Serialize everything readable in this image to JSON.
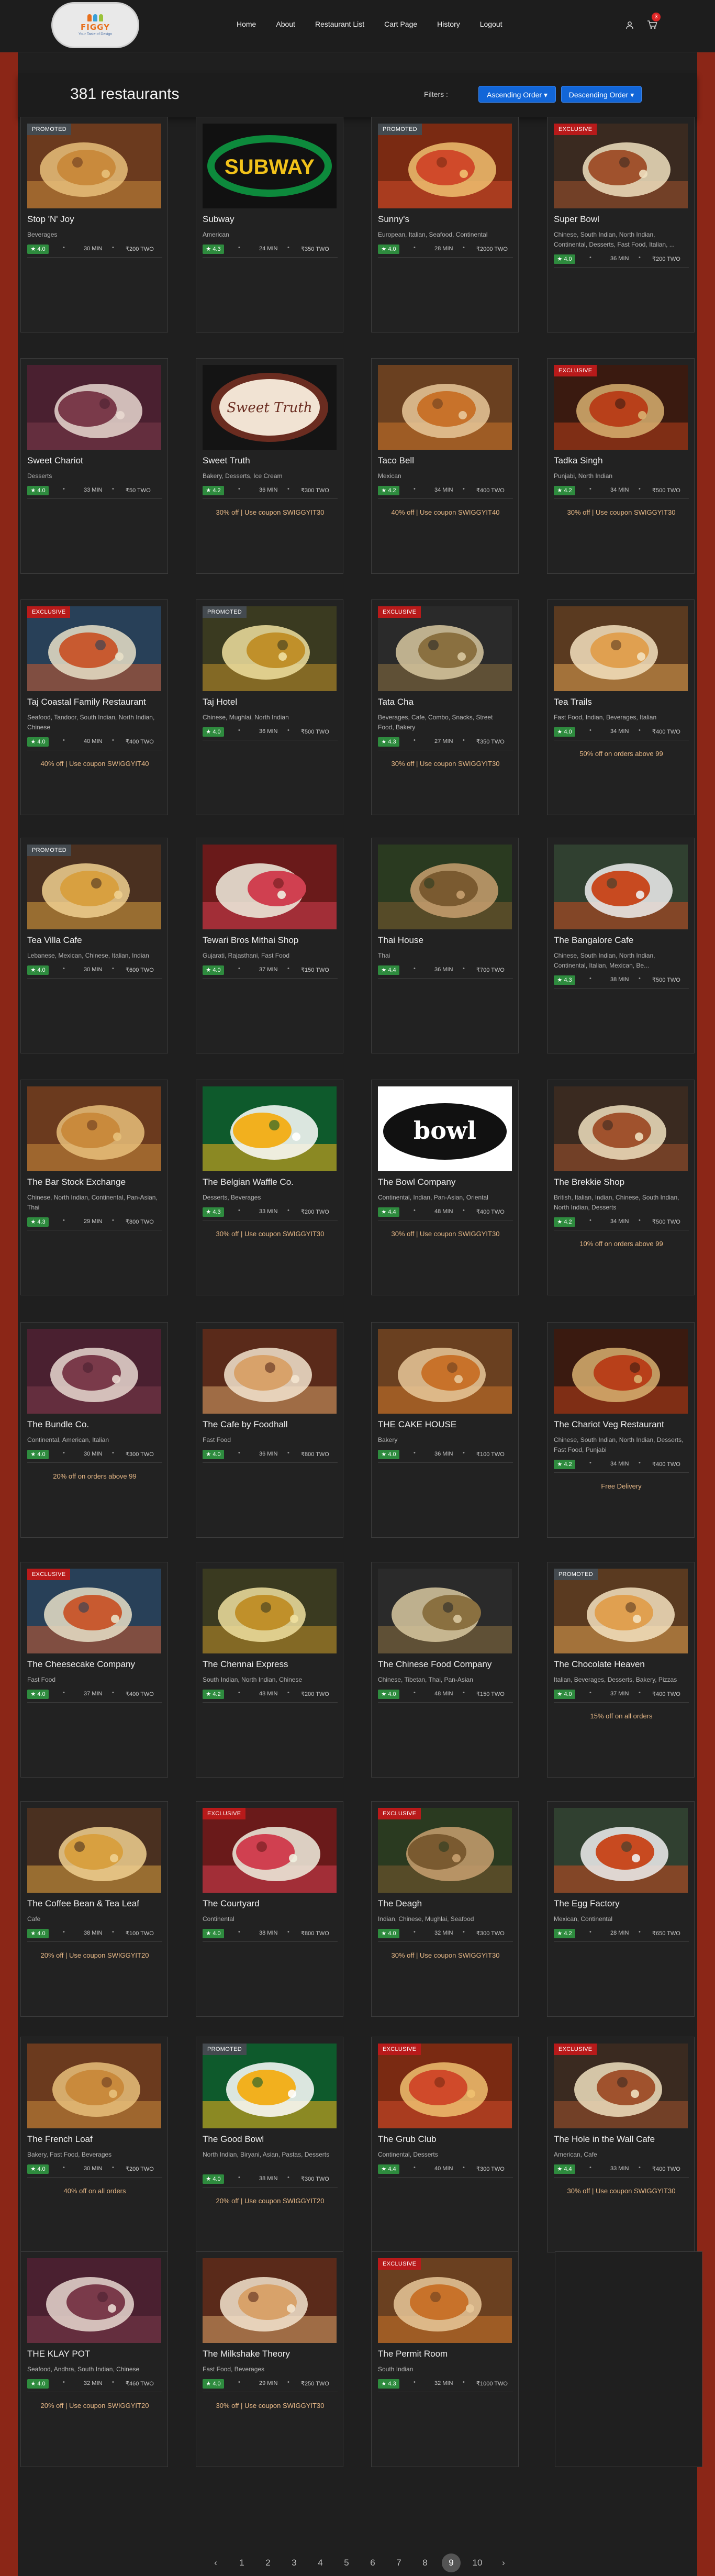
{
  "brand": {
    "name": "FIGGY",
    "tagline": "Your Taste of Design",
    "colors": {
      "accent": "#e86f1c",
      "primary_button": "#1266d8",
      "promoted": "#444a4f",
      "exclusive": "#b81a1a",
      "rating": "#2e8b3e",
      "side_band": "#8b2617"
    }
  },
  "nav": {
    "links": [
      "Home",
      "About",
      "Restaurant List",
      "Cart Page",
      "History",
      "Logout"
    ],
    "user_icon": "user-icon",
    "cart_icon": "cart-icon",
    "cart_count": "3"
  },
  "list_header": {
    "title": "381 restaurants",
    "filters_label": "Filters :",
    "sort_ascending": "Ascending Order",
    "sort_descending": "Descending Order"
  },
  "restaurants": [
    {
      "name": "Stop 'N' Joy",
      "cuisine": "Beverages",
      "rating": "4.0",
      "time": "30 MIN",
      "cost": "₹200 TWO",
      "badge": "PROMOTED",
      "offer": "",
      "image": "burger-photo"
    },
    {
      "name": "Subway",
      "cuisine": "American",
      "rating": "4.3",
      "time": "24 MIN",
      "cost": "₹350 TWO",
      "badge": "",
      "offer": "",
      "image": "subway-logo"
    },
    {
      "name": "Sunny's",
      "cuisine": "European, Italian, Seafood, Continental",
      "rating": "4.0",
      "time": "28 MIN",
      "cost": "₹2000 TWO",
      "badge": "PROMOTED",
      "offer": "",
      "image": "pizza-photo"
    },
    {
      "name": "Super Bowl",
      "cuisine": "Chinese, South Indian, North Indian, Continental, Desserts, Fast Food, Italian, ...",
      "rating": "4.0",
      "time": "36 MIN",
      "cost": "₹200 TWO",
      "badge": "EXCLUSIVE",
      "offer": "",
      "image": "curry-bowl-photo"
    },
    {
      "name": "Sweet Chariot",
      "cuisine": "Desserts",
      "rating": "4.0",
      "time": "33 MIN",
      "cost": "₹50 TWO",
      "badge": "",
      "offer": "",
      "image": "cake-photo"
    },
    {
      "name": "Sweet Truth",
      "cuisine": "Bakery, Desserts, Ice Cream",
      "rating": "4.2",
      "time": "36 MIN",
      "cost": "₹300 TWO",
      "badge": "",
      "offer": "30% off | Use coupon SWIGGYIT30",
      "image": "sweet-truth-logo"
    },
    {
      "name": "Taco Bell",
      "cuisine": "Mexican",
      "rating": "4.2",
      "time": "34 MIN",
      "cost": "₹400 TWO",
      "badge": "",
      "offer": "40% off | Use coupon SWIGGYIT40",
      "image": "taco-photo"
    },
    {
      "name": "Tadka Singh",
      "cuisine": "Punjabi, North Indian",
      "rating": "4.2",
      "time": "34 MIN",
      "cost": "₹500 TWO",
      "badge": "EXCLUSIVE",
      "offer": "30% off | Use coupon SWIGGYIT30",
      "image": "thali-photo"
    },
    {
      "name": "Taj Coastal Family Restaurant",
      "cuisine": "Seafood, Tandoor, South Indian, North Indian, Chinese",
      "rating": "4.0",
      "time": "40 MIN",
      "cost": "₹400 TWO",
      "badge": "EXCLUSIVE",
      "offer": "40% off | Use coupon SWIGGYIT40",
      "image": "sandwich-platter-photo"
    },
    {
      "name": "Taj Hotel",
      "cuisine": "Chinese, Mughlai, North Indian",
      "rating": "4.0",
      "time": "36 MIN",
      "cost": "₹500 TWO",
      "badge": "PROMOTED",
      "offer": "",
      "image": "biryani-photo"
    },
    {
      "name": "Tata Cha",
      "cuisine": "Beverages, Cafe, Combo, Snacks, Street Food, Bakery",
      "rating": "4.3",
      "time": "27 MIN",
      "cost": "₹350 TWO",
      "badge": "EXCLUSIVE",
      "offer": "30% off | Use coupon SWIGGYIT30",
      "image": "samosa-photo"
    },
    {
      "name": "Tea Trails",
      "cuisine": "Fast Food, Indian, Beverages, Italian",
      "rating": "4.0",
      "time": "34 MIN",
      "cost": "₹400 TWO",
      "badge": "",
      "offer": "50% off on orders above 99",
      "image": "tea-cups-photo"
    },
    {
      "name": "Tea Villa Cafe",
      "cuisine": "Lebanese, Mexican, Chinese, Italian, Indian",
      "rating": "4.0",
      "time": "30 MIN",
      "cost": "₹600 TWO",
      "badge": "PROMOTED",
      "offer": "",
      "image": "lasagna-photo"
    },
    {
      "name": "Tewari Bros Mithai Shop",
      "cuisine": "Gujarati, Rajasthani, Fast Food",
      "rating": "4.0",
      "time": "37 MIN",
      "cost": "₹150 TWO",
      "badge": "",
      "offer": "",
      "image": "mithai-photo"
    },
    {
      "name": "Thai House",
      "cuisine": "Thai",
      "rating": "4.4",
      "time": "36 MIN",
      "cost": "₹700 TWO",
      "badge": "",
      "offer": "",
      "image": "thai-food-photo"
    },
    {
      "name": "The Bangalore Cafe",
      "cuisine": "Chinese, South Indian, North Indian, Continental, Italian, Mexican, Be...",
      "rating": "4.3",
      "time": "38 MIN",
      "cost": "₹500 TWO",
      "badge": "",
      "offer": "",
      "image": "bento-photo"
    },
    {
      "name": "The Bar Stock Exchange",
      "cuisine": "Chinese, North Indian, Continental, Pan-Asian, Thai",
      "rating": "4.3",
      "time": "29 MIN",
      "cost": "₹800 TWO",
      "badge": "",
      "offer": "",
      "image": "noodle-bowl-photo"
    },
    {
      "name": "The Belgian Waffle Co.",
      "cuisine": "Desserts, Beverages",
      "rating": "4.3",
      "time": "33 MIN",
      "cost": "₹200 TWO",
      "badge": "",
      "offer": "30% off | Use coupon SWIGGYIT30",
      "image": "waffle-photo"
    },
    {
      "name": "The Bowl Company",
      "cuisine": "Continental, Indian, Pan-Asian, Oriental",
      "rating": "4.4",
      "time": "48 MIN",
      "cost": "₹400 TWO",
      "badge": "",
      "offer": "30% off | Use coupon SWIGGYIT30",
      "image": "bowl-company-logo"
    },
    {
      "name": "The Brekkie Shop",
      "cuisine": "British, Italian, Indian, Chinese, South Indian, North Indian, Desserts",
      "rating": "4.2",
      "time": "34 MIN",
      "cost": "₹500 TWO",
      "badge": "",
      "offer": "10% off on orders above 99",
      "image": "toast-photo"
    },
    {
      "name": "The Bundle Co.",
      "cuisine": "Continental, American, Italian",
      "rating": "4.0",
      "time": "30 MIN",
      "cost": "₹300 TWO",
      "badge": "",
      "offer": "20% off on orders above 99",
      "image": "burger-photo-2"
    },
    {
      "name": "The Cafe by Foodhall",
      "cuisine": "Fast Food",
      "rating": "4.0",
      "time": "36 MIN",
      "cost": "₹800 TWO",
      "badge": "",
      "offer": "",
      "image": "omelette-photo"
    },
    {
      "name": "THE CAKE HOUSE",
      "cuisine": "Bakery",
      "rating": "4.0",
      "time": "36 MIN",
      "cost": "₹100 TWO",
      "badge": "",
      "offer": "",
      "image": "cookies-photo"
    },
    {
      "name": "The Chariot Veg Restaurant",
      "cuisine": "Chinese, South Indian, North Indian, Desserts, Fast Food, Punjabi",
      "rating": "4.2",
      "time": "34 MIN",
      "cost": "₹400 TWO",
      "badge": "",
      "offer": "Free Delivery",
      "image": "paneer-curry-photo"
    },
    {
      "name": "The Cheesecake Company",
      "cuisine": "Fast Food",
      "rating": "4.0",
      "time": "37 MIN",
      "cost": "₹400 TWO",
      "badge": "EXCLUSIVE",
      "offer": "",
      "image": "cheesecake-photo"
    },
    {
      "name": "The Chennai Express",
      "cuisine": "South Indian, North Indian, Chinese",
      "rating": "4.2",
      "time": "48 MIN",
      "cost": "₹200 TWO",
      "badge": "",
      "offer": "",
      "image": "idli-photo"
    },
    {
      "name": "The Chinese Food Company",
      "cuisine": "Chinese, Tibetan, Thai, Pan-Asian",
      "rating": "4.0",
      "time": "48 MIN",
      "cost": "₹150 TWO",
      "badge": "",
      "offer": "",
      "image": "chilli-chicken-photo"
    },
    {
      "name": "The Chocolate Heaven",
      "cuisine": "Italian, Beverages, Desserts, Bakery, Pizzas",
      "rating": "4.0",
      "time": "37 MIN",
      "cost": "₹400 TWO",
      "badge": "PROMOTED",
      "offer": "15% off on all orders",
      "image": "chocolate-cake-photo"
    },
    {
      "name": "The Coffee Bean & Tea Leaf",
      "cuisine": "Cafe",
      "rating": "4.0",
      "time": "38 MIN",
      "cost": "₹100 TWO",
      "badge": "",
      "offer": "20% off | Use coupon SWIGGYIT20",
      "image": "sandwich-photo"
    },
    {
      "name": "The Courtyard",
      "cuisine": "Continental",
      "rating": "4.0",
      "time": "38 MIN",
      "cost": "₹800 TWO",
      "badge": "EXCLUSIVE",
      "offer": "",
      "image": "iced-drink-photo"
    },
    {
      "name": "The Deagh",
      "cuisine": "Indian, Chinese, Mughlai, Seafood",
      "rating": "4.0",
      "time": "32 MIN",
      "cost": "₹300 TWO",
      "badge": "EXCLUSIVE",
      "offer": "30% off | Use coupon SWIGGYIT30",
      "image": "skewers-photo"
    },
    {
      "name": "The Egg Factory",
      "cuisine": "Mexican, Continental",
      "rating": "4.2",
      "time": "28 MIN",
      "cost": "₹650 TWO",
      "badge": "",
      "offer": "",
      "image": "egg-dish-photo"
    },
    {
      "name": "The French Loaf",
      "cuisine": "Bakery, Fast Food, Beverages",
      "rating": "4.0",
      "time": "30 MIN",
      "cost": "₹200 TWO",
      "badge": "",
      "offer": "40% off on all orders",
      "image": "black-forest-cake-photo"
    },
    {
      "name": "The Good Bowl",
      "cuisine": "North Indian, Biryani, Asian, Pastas, Desserts",
      "rating": "4.0",
      "time": "38 MIN",
      "cost": "₹300 TWO",
      "badge": "PROMOTED",
      "offer": "20% off | Use coupon SWIGGYIT20",
      "image": "rice-bowl-photo"
    },
    {
      "name": "The Grub Club",
      "cuisine": "Continental, Desserts",
      "rating": "4.4",
      "time": "40 MIN",
      "cost": "₹300 TWO",
      "badge": "EXCLUSIVE",
      "offer": "",
      "image": "burger-plate-photo"
    },
    {
      "name": "The Hole in the Wall Cafe",
      "cuisine": "American, Cafe",
      "rating": "4.4",
      "time": "33 MIN",
      "cost": "₹400 TWO",
      "badge": "EXCLUSIVE",
      "offer": "30% off | Use coupon SWIGGYIT30",
      "image": "breakfast-plate-photo"
    },
    {
      "name": "THE KLAY POT",
      "cuisine": "Seafood, Andhra, South Indian, Chinese",
      "rating": "4.0",
      "time": "32 MIN",
      "cost": "₹460 TWO",
      "badge": "",
      "offer": "20% off | Use coupon SWIGGYIT20",
      "image": "fish-curry-photo"
    },
    {
      "name": "The Milkshake Theory",
      "cuisine": "Fast Food, Beverages",
      "rating": "4.0",
      "time": "29 MIN",
      "cost": "₹250 TWO",
      "badge": "",
      "offer": "30% off | Use coupon SWIGGYIT30",
      "image": "milkshake-photo"
    },
    {
      "name": "The Permit Room",
      "cuisine": "South Indian",
      "rating": "4.3",
      "time": "32 MIN",
      "cost": "₹1000 TWO",
      "badge": "EXCLUSIVE",
      "offer": "",
      "image": "noodles-plate-photo"
    }
  ],
  "pagination": {
    "prev_icon": "chevron-left-icon",
    "next_icon": "chevron-right-icon",
    "pages": [
      "1",
      "2",
      "3",
      "4",
      "5",
      "6",
      "7",
      "8",
      "9",
      "10"
    ],
    "current": "9"
  }
}
